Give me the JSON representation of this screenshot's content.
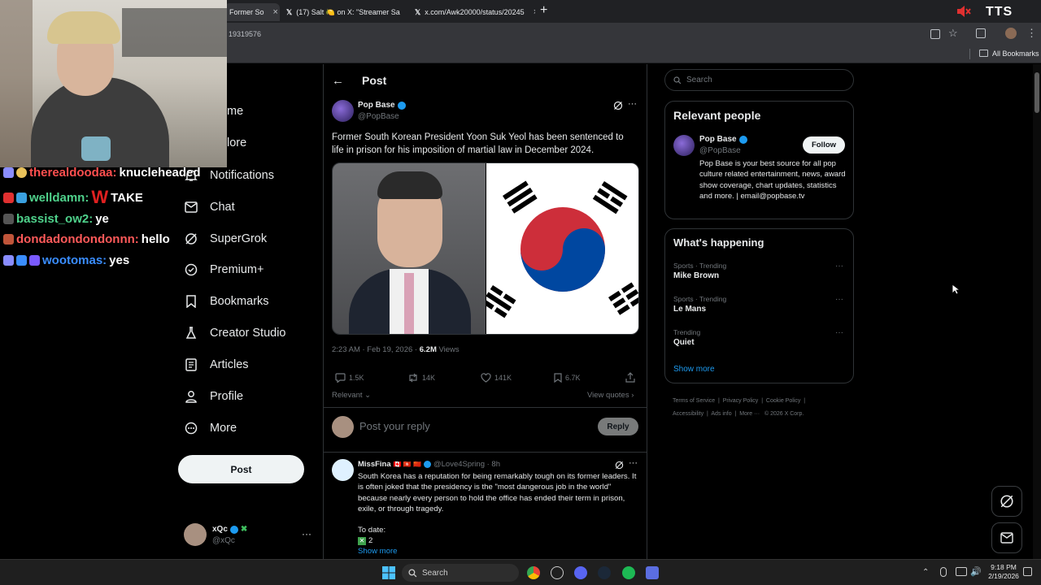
{
  "browser": {
    "tabs": [
      {
        "title": "Former So"
      },
      {
        "title": "(17) Salt 🍋 on X: \"Streamer Sa"
      },
      {
        "title": "x.com/Awk20000/status/20245"
      }
    ],
    "url_fragment": "19319576",
    "bookmarks_label": "All Bookmarks",
    "tts_label": "TTS"
  },
  "chat": [
    {
      "user": "therealdoodaa:",
      "message": "knucleheaded",
      "color": "#ff4f4f"
    },
    {
      "user": "welldamn:",
      "prefix": "W",
      "message": "TAKE",
      "color": "#4fd18b"
    },
    {
      "user": "bassist_ow2:",
      "message": "ye",
      "color": "#4fd18b"
    },
    {
      "user": "dondadondondonnn:",
      "message": "hello",
      "color": "#ff5a5a"
    },
    {
      "user": "wootomas:",
      "message": "yes",
      "color": "#3a8dff"
    }
  ],
  "nav": {
    "partial": [
      "me",
      "lore"
    ],
    "items": [
      {
        "label": "Notifications",
        "icon": "bell-icon"
      },
      {
        "label": "Chat",
        "icon": "mail-icon"
      },
      {
        "label": "SuperGrok",
        "icon": "grok-icon"
      },
      {
        "label": "Premium+",
        "icon": "premium-icon"
      },
      {
        "label": "Bookmarks",
        "icon": "bookmark-icon"
      },
      {
        "label": "Creator Studio",
        "icon": "flask-icon"
      },
      {
        "label": "Articles",
        "icon": "article-icon"
      },
      {
        "label": "Profile",
        "icon": "profile-icon"
      },
      {
        "label": "More",
        "icon": "more-circle-icon"
      }
    ],
    "post_button": "Post",
    "account": {
      "name": "xQc",
      "handle": "@xQc"
    }
  },
  "post": {
    "header": "Post",
    "author": {
      "name": "Pop Base",
      "handle": "@PopBase"
    },
    "text": "Former South Korean President Yoon Suk Yeol has been sentenced to life in prison for his imposition of martial law in December 2024.",
    "timestamp": "2:23 AM · Feb 19, 2026 ·",
    "views_count": "6.2M",
    "views_label": "Views",
    "stats": {
      "replies": "1.5K",
      "reposts": "14K",
      "likes": "141K",
      "bookmarks": "6.7K"
    },
    "sort_label": "Relevant",
    "view_quotes": "View quotes",
    "reply_placeholder": "Post your reply",
    "reply_button": "Reply"
  },
  "reply": {
    "name": "MissFina",
    "flags": "🇨🇦 🇭🇰 🇨🇳",
    "handle": "@Love4Spring · 8h",
    "text": "South Korea has a reputation for being remarkably tough on its former leaders. It is often joked that the presidency is the \"most dangerous job in the world\" because nearly every person to hold the office has ended their term in prison, exile, or through tragedy.",
    "to_date": "To date:",
    "count_line": "2",
    "show_more": "Show more"
  },
  "sidebar": {
    "search_placeholder": "Search",
    "relevant_title": "Relevant people",
    "person": {
      "name": "Pop Base",
      "handle": "@PopBase",
      "follow": "Follow",
      "bio": "Pop Base is your best source for all pop culture related entertainment, news, award show coverage, chart updates, statistics and more. | email@popbase.tv"
    },
    "happening_title": "What's happening",
    "trends": [
      {
        "context": "Sports · Trending",
        "name": "Mike Brown"
      },
      {
        "context": "Sports · Trending",
        "name": "Le Mans"
      },
      {
        "context": "Trending",
        "name": "Quiet"
      }
    ],
    "show_more": "Show more",
    "footer": {
      "terms": "Terms of Service",
      "privacy": "Privacy Policy",
      "cookie": "Cookie Policy",
      "accessibility": "Accessibility",
      "ads": "Ads info",
      "more": "More ···",
      "copyright": "© 2026 X Corp."
    }
  },
  "taskbar": {
    "search_label": "Search",
    "time": "9:18 PM",
    "date": "2/19/2026"
  },
  "colors": {
    "accent": "#1d9bf0",
    "verified": "#1d9bf0",
    "tab_bg": "#202124"
  }
}
